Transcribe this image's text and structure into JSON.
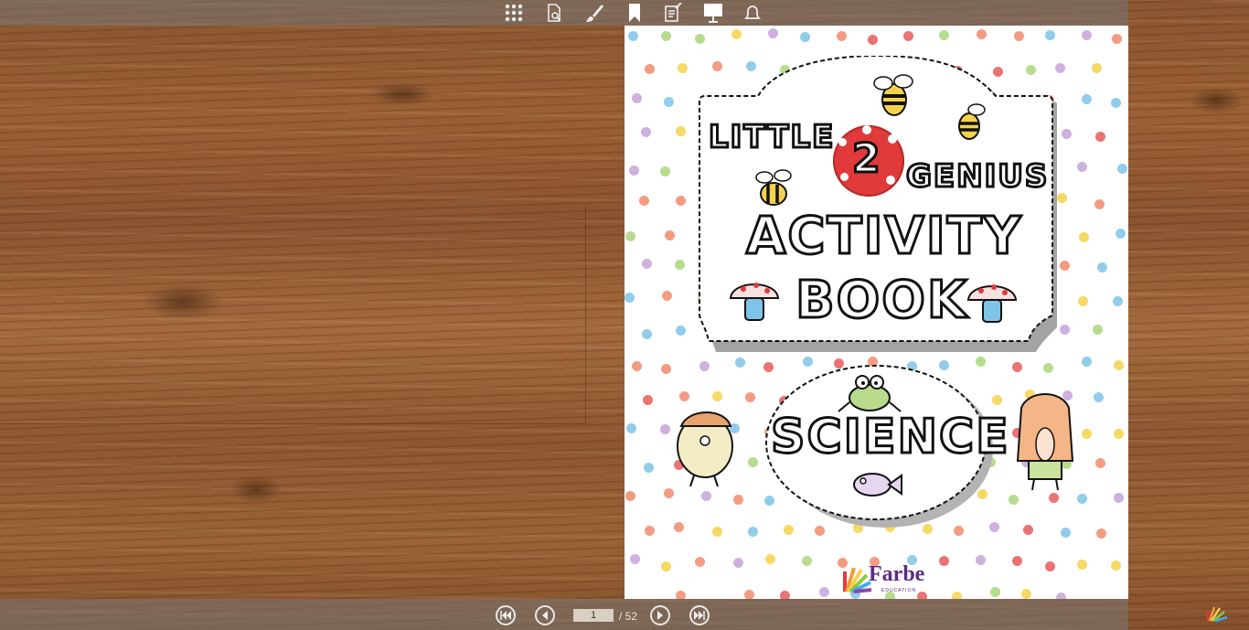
{
  "toolbar": {
    "icons": [
      "thumbnails-icon",
      "search-document-icon",
      "brush-icon",
      "bookmark-icon",
      "notes-icon",
      "presentation-icon",
      "bell-icon"
    ]
  },
  "book": {
    "cover": {
      "line1_left": "LITTLE",
      "number": "2",
      "line1_right": "GENIUS",
      "line2": "ACTIVITY",
      "line3": "BOOK",
      "subject": "SCIENCE",
      "publisher": "Farbe",
      "publisher_sub": "EDUCATION"
    }
  },
  "navigation": {
    "current_page": "1",
    "total_pages": "/ 52"
  },
  "colors": {
    "toolbar_bg": "#787878",
    "page_bg": "#ffffff",
    "badge_red": "#e03a3a",
    "dot_colors": [
      "#7ec4e8",
      "#f28b6b",
      "#c5a3d9",
      "#a9d67a",
      "#f5d24a",
      "#e85b5b"
    ]
  }
}
